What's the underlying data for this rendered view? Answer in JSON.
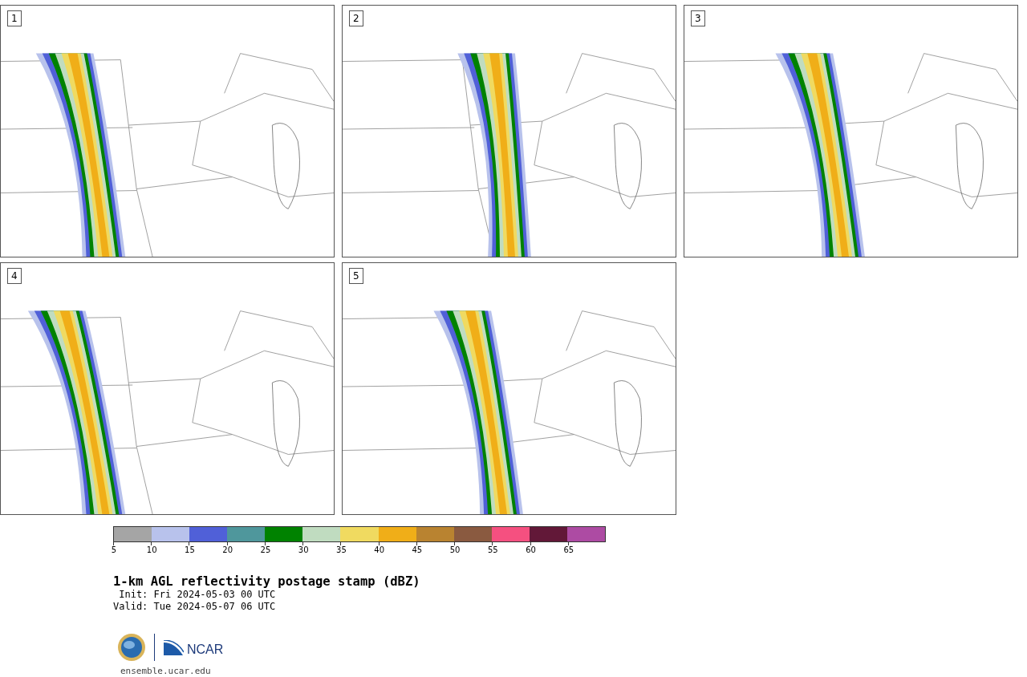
{
  "panels": [
    {
      "label": "1"
    },
    {
      "label": "2"
    },
    {
      "label": "3"
    },
    {
      "label": "4"
    },
    {
      "label": "5"
    }
  ],
  "colorbar": {
    "bins": [
      {
        "color": "#a5a5a5"
      },
      {
        "color": "#b8c2ec"
      },
      {
        "color": "#5060d8"
      },
      {
        "color": "#4f979c"
      },
      {
        "color": "#008200"
      },
      {
        "color": "#c0dcc0"
      },
      {
        "color": "#f0da60"
      },
      {
        "color": "#f0ae18"
      },
      {
        "color": "#b98330"
      },
      {
        "color": "#8a5a40"
      },
      {
        "color": "#f55080"
      },
      {
        "color": "#621838"
      },
      {
        "color": "#ad4ba3"
      }
    ],
    "ticks": [
      "5",
      "10",
      "15",
      "20",
      "25",
      "30",
      "35",
      "40",
      "45",
      "50",
      "55",
      "60",
      "65"
    ]
  },
  "title": "1-km AGL reflectivity postage stamp (dBZ)",
  "init": " Init: Fri 2024-05-03 00 UTC",
  "valid": "Valid: Tue 2024-05-07 06 UTC",
  "logo_text": "NCAR",
  "site": "ensemble.ucar.edu"
}
